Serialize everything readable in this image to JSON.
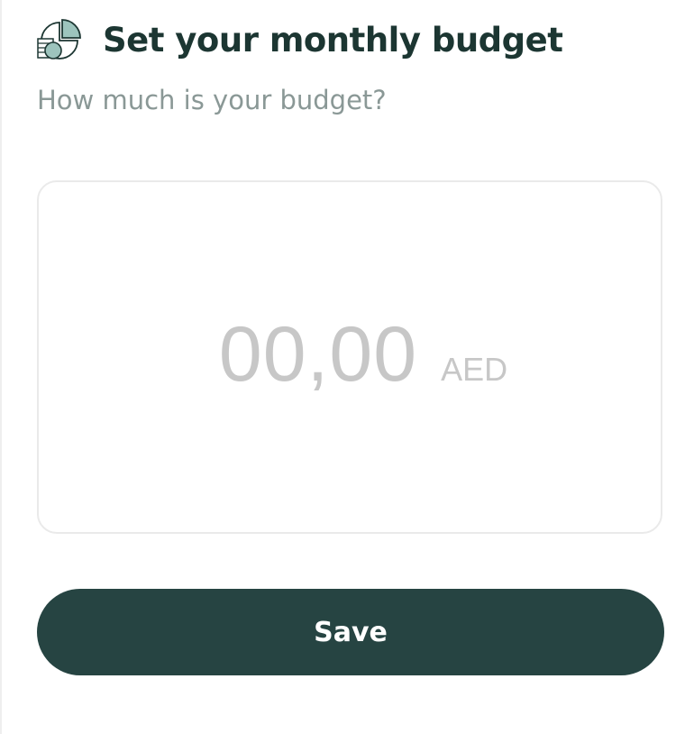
{
  "header": {
    "icon": "budget-pie-coins-icon",
    "title": "Set your monthly budget"
  },
  "subtitle": "How much is your budget?",
  "amount": {
    "placeholder": "00,00",
    "currency": "AED"
  },
  "actions": {
    "save_label": "Save"
  },
  "colors": {
    "primary": "#264442",
    "title": "#1c3632",
    "subtitle": "#8a9896",
    "placeholder": "#c7c7c7",
    "icon_accent": "#9dc4bd"
  }
}
